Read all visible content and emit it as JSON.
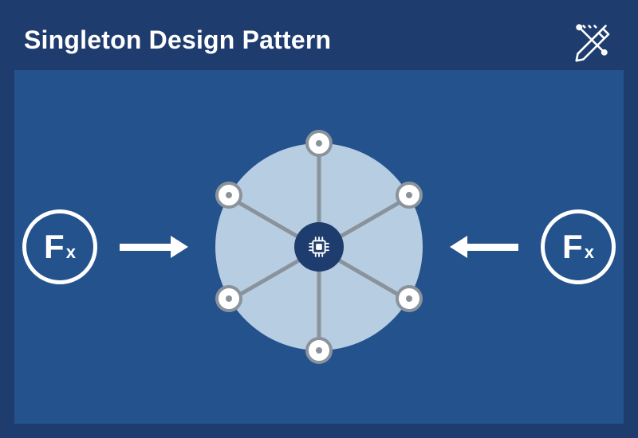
{
  "title": "Singleton Design Pattern",
  "colors": {
    "page_bg": "#1f3c6e",
    "canvas_bg": "#24528d",
    "hub_fill": "#b6cde2",
    "spoke": "#8a939c",
    "accent": "#ffffff"
  },
  "left_badge": {
    "main": "F",
    "sub": "x"
  },
  "right_badge": {
    "main": "F",
    "sub": "x"
  },
  "hub": {
    "center_icon": "cpu-chip-icon",
    "node_count": 6
  },
  "header_icon": "design-tools-icon"
}
